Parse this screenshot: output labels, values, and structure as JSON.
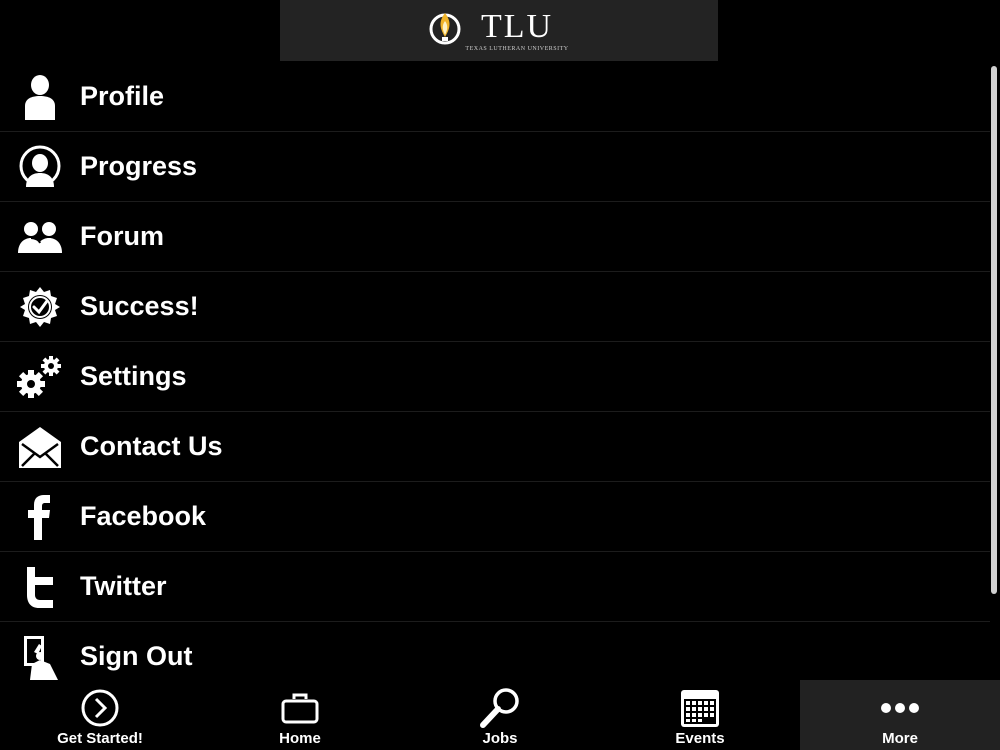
{
  "header": {
    "logo_text": "TLU",
    "logo_subtitle": "Texas Lutheran University"
  },
  "menu": {
    "items": [
      {
        "label": "Profile",
        "icon": "person-icon"
      },
      {
        "label": "Progress",
        "icon": "progress-person-icon"
      },
      {
        "label": "Forum",
        "icon": "group-icon"
      },
      {
        "label": "Success!",
        "icon": "check-badge-icon"
      },
      {
        "label": "Settings",
        "icon": "gears-icon"
      },
      {
        "label": "Contact Us",
        "icon": "envelope-icon"
      },
      {
        "label": "Facebook",
        "icon": "facebook-icon"
      },
      {
        "label": "Twitter",
        "icon": "twitter-icon"
      },
      {
        "label": "Sign Out",
        "icon": "sign-out-icon"
      }
    ]
  },
  "tabbar": {
    "tabs": [
      {
        "label": "Get Started!",
        "icon": "chevron-circle-icon",
        "active": false
      },
      {
        "label": "Home",
        "icon": "briefcase-icon",
        "active": false
      },
      {
        "label": "Jobs",
        "icon": "magnifier-icon",
        "active": false
      },
      {
        "label": "Events",
        "icon": "calendar-icon",
        "active": false
      },
      {
        "label": "More",
        "icon": "more-dots-icon",
        "active": true
      }
    ]
  },
  "colors": {
    "background": "#000000",
    "logo_box": "#232323",
    "active_tab": "#222222",
    "text": "#ffffff",
    "logo_flame": "#f0b429"
  }
}
